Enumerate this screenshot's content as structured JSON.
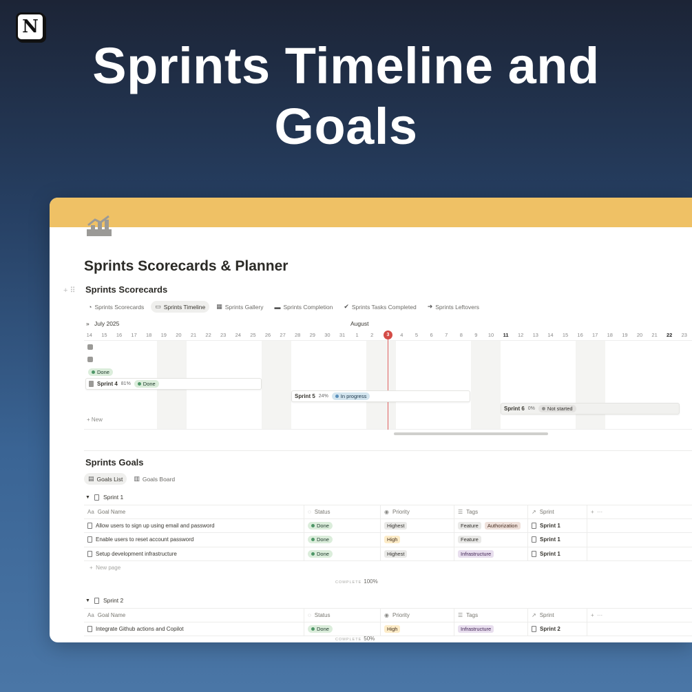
{
  "logo_letter": "N",
  "hero": {
    "line1": "Sprints Timeline and",
    "line2": "Goals"
  },
  "page": {
    "title": "Sprints Scorecards & Planner"
  },
  "scorecards": {
    "title": "Sprints Scorecards",
    "views": [
      {
        "label": "Sprints Scorecards",
        "icon": "scorecard-icon"
      },
      {
        "label": "Sprints Timeline",
        "icon": "timeline-icon"
      },
      {
        "label": "Sprints Gallery",
        "icon": "gallery-icon"
      },
      {
        "label": "Sprints Completion",
        "icon": "completion-icon"
      },
      {
        "label": "Sprints Tasks Completed",
        "icon": "check-circle-icon"
      },
      {
        "label": "Sprints Leftovers",
        "icon": "arrow-circle-icon"
      }
    ],
    "active_view": 1
  },
  "timeline": {
    "month_july": "July 2025",
    "month_august": "August",
    "days": [
      "14",
      "15",
      "16",
      "17",
      "18",
      "19",
      "20",
      "21",
      "22",
      "23",
      "24",
      "25",
      "26",
      "27",
      "28",
      "29",
      "30",
      "31",
      "1",
      "2",
      "3",
      "4",
      "5",
      "6",
      "7",
      "8",
      "9",
      "10",
      "11",
      "12",
      "13",
      "14",
      "15",
      "16",
      "17",
      "18",
      "19",
      "20",
      "21",
      "22",
      "23"
    ],
    "today": "3",
    "bars": [
      {
        "name": "",
        "pct": "",
        "status": "Done"
      },
      {
        "name": "Sprint 4",
        "pct": "81%",
        "status": "Done"
      },
      {
        "name": "Sprint 5",
        "pct": "24%",
        "status": "In progress"
      },
      {
        "name": "Sprint 6",
        "pct": "0%",
        "status": "Not started"
      }
    ],
    "new_label": "New"
  },
  "goals": {
    "title": "Sprints Goals",
    "views": [
      {
        "label": "Goals List",
        "icon": "list-icon"
      },
      {
        "label": "Goals Board",
        "icon": "board-icon"
      }
    ],
    "columns": [
      "Goal Name",
      "Status",
      "Priority",
      "Tags",
      "Sprint"
    ],
    "groups": [
      {
        "name": "Sprint 1",
        "rows": [
          {
            "goal": "Allow users to sign up using email and password",
            "status": "Done",
            "priority": "Highest",
            "tags": [
              "Feature",
              "Authorization"
            ],
            "sprint": "Sprint 1"
          },
          {
            "goal": "Enable users to reset account password",
            "status": "Done",
            "priority": "High",
            "tags": [
              "Feature"
            ],
            "sprint": "Sprint 1"
          },
          {
            "goal": "Setup development infrastructure",
            "status": "Done",
            "priority": "Highest",
            "tags": [
              "Infrastructure"
            ],
            "sprint": "Sprint 1"
          }
        ],
        "new_page": "New page",
        "complete_label": "COMPLETE",
        "complete_value": "100%"
      },
      {
        "name": "Sprint 2",
        "rows": [
          {
            "goal": "Integrate Github actions and Copilot",
            "status": "Done",
            "priority": "High",
            "tags": [
              "Infrastructure"
            ],
            "sprint": "Sprint 2"
          }
        ],
        "complete_label": "COMPLETE",
        "complete_value": "50%"
      }
    ]
  }
}
